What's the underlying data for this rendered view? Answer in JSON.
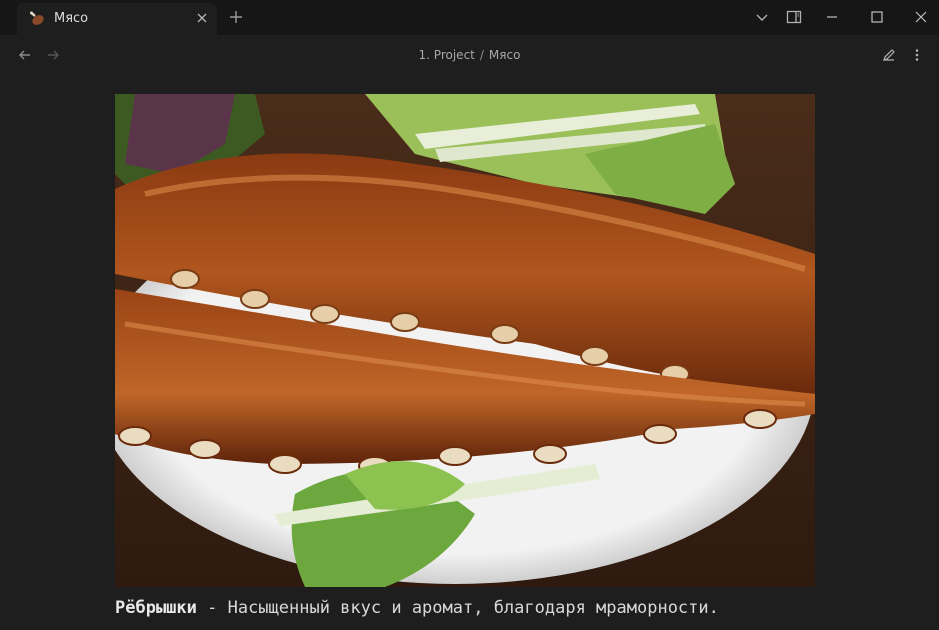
{
  "tab": {
    "title": "Мясо",
    "favicon": "meat-icon"
  },
  "breadcrumb": {
    "parent": "1. Project",
    "separator": "/",
    "current": "Мясо"
  },
  "content": {
    "image_alt": "ribs-photo",
    "caption_bold": "Рёбрышки",
    "caption_rest": " - Насыщенный вкус и аромат, благодаря мраморности."
  },
  "colors": {
    "background": "#1e1e1e",
    "titlebar": "#161616",
    "text": "#dadada"
  }
}
